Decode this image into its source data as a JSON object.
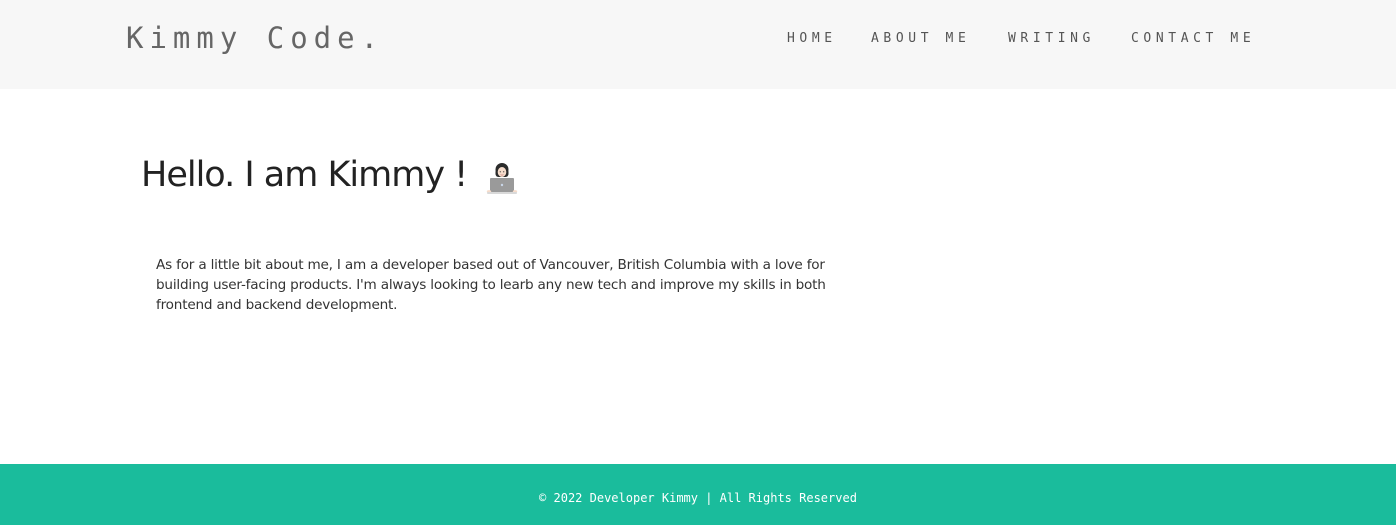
{
  "header": {
    "brand": "Kimmy Code.",
    "nav": [
      "HOME",
      "ABOUT ME",
      "WRITING",
      "CONTACT ME"
    ]
  },
  "main": {
    "title": "Hello. I am Kimmy !",
    "emoji_icon": "woman-technologist-icon",
    "bio": "As for a little bit about me, I am a developer based out of Vancouver, British Columbia with a love for building user-facing products. I'm always looking to learb any new tech and improve my skills in both frontend and backend development."
  },
  "footer": {
    "copyright": "© 2022 Developer Kimmy | All Rights Reserved"
  },
  "colors": {
    "header_bg": "#f7f7f7",
    "footer_bg": "#1abc9c",
    "text": "#333333"
  }
}
